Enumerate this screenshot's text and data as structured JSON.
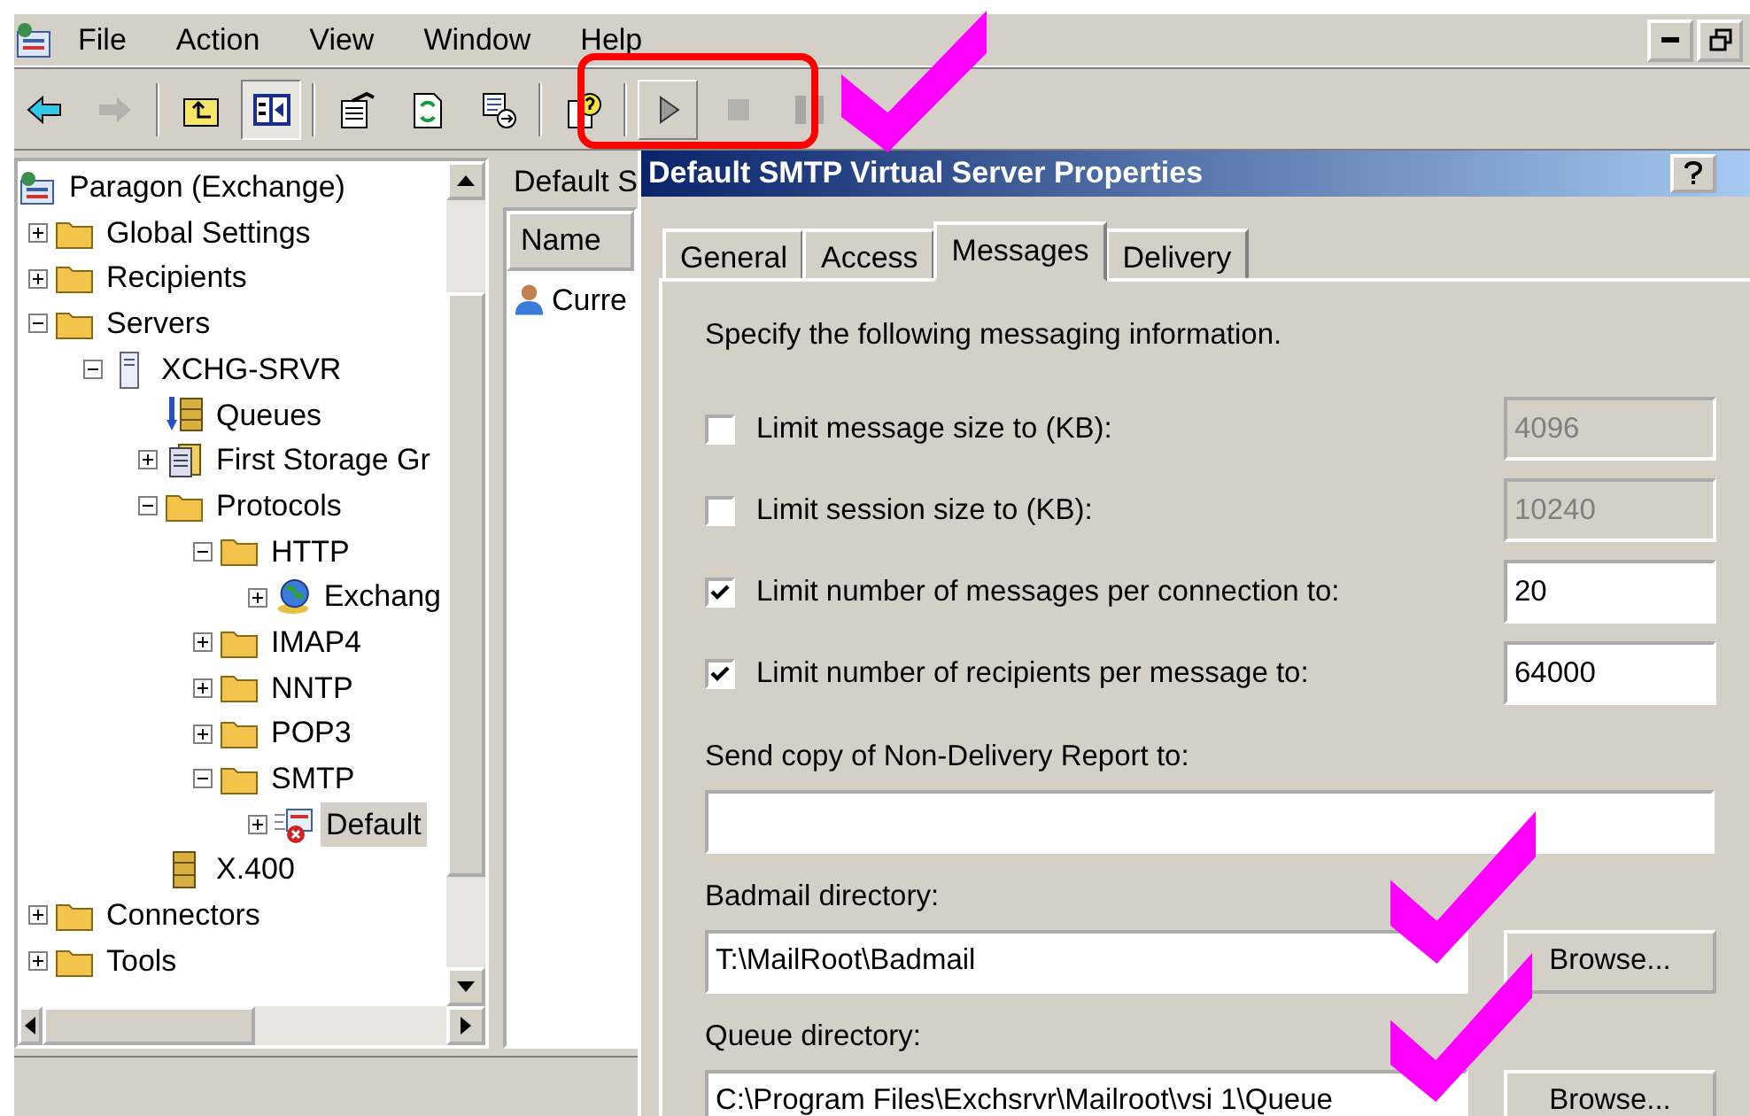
{
  "menu": [
    "File",
    "Action",
    "View",
    "Window",
    "Help"
  ],
  "window_controls": [
    {
      "kind": "minimize"
    },
    {
      "kind": "restore"
    }
  ],
  "toolbar": [
    {
      "kind": "back",
      "disabled": false,
      "pressed": false
    },
    {
      "kind": "forward",
      "disabled": true,
      "pressed": false
    },
    {
      "kind": "sep"
    },
    {
      "kind": "up",
      "disabled": false,
      "pressed": false
    },
    {
      "kind": "tree",
      "disabled": false,
      "pressed": true
    },
    {
      "kind": "sep"
    },
    {
      "kind": "properties",
      "disabled": false,
      "pressed": false
    },
    {
      "kind": "refresh",
      "disabled": false,
      "pressed": false
    },
    {
      "kind": "export",
      "disabled": false,
      "pressed": false
    },
    {
      "kind": "sep"
    },
    {
      "kind": "help",
      "disabled": false,
      "pressed": false
    },
    {
      "kind": "sep"
    },
    {
      "kind": "start",
      "disabled": false,
      "pressed": false
    },
    {
      "kind": "stop",
      "disabled": true,
      "pressed": false
    },
    {
      "kind": "pause",
      "disabled": true,
      "pressed": false
    }
  ],
  "tree": {
    "label": "Paragon (Exchange)",
    "kind": "org",
    "children": [
      {
        "label": "Global Settings",
        "kind": "folder",
        "expanded": false,
        "selected": false
      },
      {
        "label": "Recipients",
        "kind": "folder",
        "expanded": false,
        "selected": false
      },
      {
        "label": "Servers",
        "kind": "folder",
        "expanded": true,
        "selected": false,
        "children": [
          {
            "label": "XCHG-SRVR",
            "kind": "server",
            "expanded": true,
            "selected": false,
            "children": [
              {
                "label": "Queues",
                "kind": "queues",
                "selected": false
              },
              {
                "label": "First Storage Gr",
                "kind": "storage",
                "expanded": false,
                "selected": false
              },
              {
                "label": "Protocols",
                "kind": "folder",
                "expanded": true,
                "selected": false,
                "children": [
                  {
                    "label": "HTTP",
                    "kind": "folder",
                    "expanded": true,
                    "selected": false,
                    "children": [
                      {
                        "label": "Exchang",
                        "kind": "globe",
                        "expanded": false,
                        "selected": false
                      }
                    ]
                  },
                  {
                    "label": "IMAP4",
                    "kind": "folder",
                    "expanded": false,
                    "selected": false
                  },
                  {
                    "label": "NNTP",
                    "kind": "folder",
                    "expanded": false,
                    "selected": false
                  },
                  {
                    "label": "POP3",
                    "kind": "folder",
                    "expanded": false,
                    "selected": false
                  },
                  {
                    "label": "SMTP",
                    "kind": "folder",
                    "expanded": true,
                    "selected": false,
                    "children": [
                      {
                        "label": "Default",
                        "kind": "smtp",
                        "expanded": false,
                        "selected": true
                      }
                    ]
                  }
                ]
              },
              {
                "label": "X.400",
                "kind": "stack",
                "selected": false
              }
            ]
          }
        ]
      },
      {
        "label": "Connectors",
        "kind": "folder",
        "expanded": false,
        "selected": false
      },
      {
        "label": "Tools",
        "kind": "folder",
        "expanded": false,
        "selected": false
      }
    ]
  },
  "details": {
    "title": "Default S",
    "column": "Name",
    "rows": [
      "Curre"
    ]
  },
  "dialog": {
    "title": "Default SMTP Virtual Server Properties",
    "tabs": [
      {
        "label": "General",
        "selected": false
      },
      {
        "label": "Access",
        "selected": false
      },
      {
        "label": "Messages",
        "selected": true
      },
      {
        "label": "Delivery",
        "selected": false
      }
    ],
    "intro": "Specify the following messaging information.",
    "limits": [
      {
        "label": "Limit message size to (KB):",
        "checked": false,
        "value": "4096"
      },
      {
        "label": "Limit session size to (KB):",
        "checked": false,
        "value": "10240"
      },
      {
        "label": "Limit number of messages per connection to:",
        "checked": true,
        "value": "20"
      },
      {
        "label": "Limit number of recipients per message to:",
        "checked": true,
        "value": "64000"
      }
    ],
    "ndr": {
      "label": "Send copy of Non-Delivery Report to:"
    },
    "directories": [
      {
        "label": "Badmail directory:",
        "value": "T:\\MailRoot\\Badmail",
        "button": "Browse..."
      },
      {
        "label": "Queue directory:",
        "value": "C:\\Program Files\\Exchsrvr\\Mailroot\\vsi 1\\Queue",
        "button": "Browse..."
      }
    ]
  },
  "annotations": [
    {
      "kind": "box",
      "color": "#ff0000"
    },
    {
      "kind": "check",
      "color": "#ff00ff"
    },
    {
      "kind": "check",
      "color": "#ff00ff"
    },
    {
      "kind": "check",
      "color": "#ff00ff"
    }
  ]
}
